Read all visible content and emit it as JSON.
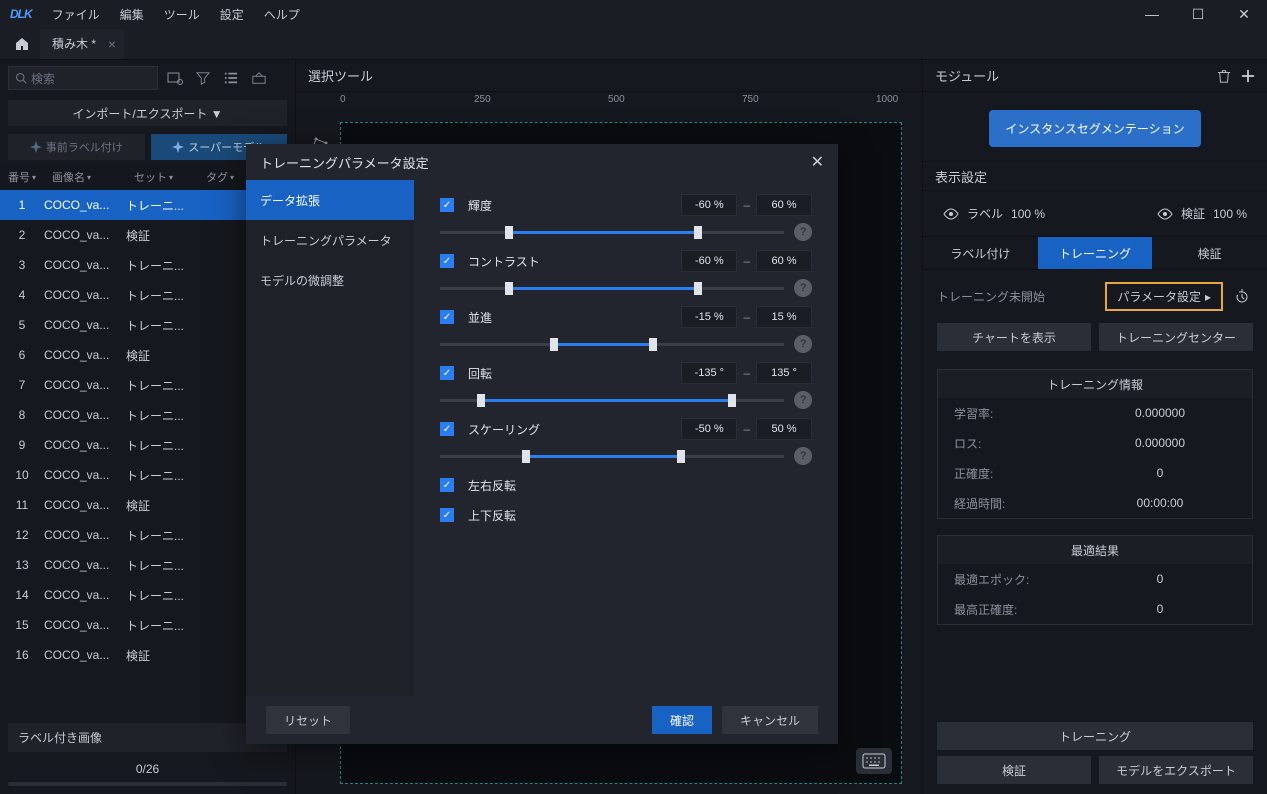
{
  "titlebar": {
    "logo": "DLK",
    "menu": {
      "file": "ファイル",
      "edit": "編集",
      "tool": "ツール",
      "settings": "設定",
      "help": "ヘルプ"
    }
  },
  "tab": {
    "name": "積み木 *"
  },
  "left": {
    "search_placeholder": "検索",
    "imp_exp": "インポート/エクスポート ▼",
    "pre_label": "事前ラベル付け",
    "super_model": "スーパーモデル",
    "cols": {
      "num": "番号",
      "name": "画像名",
      "set": "セット",
      "tag": "タグ"
    },
    "rows": [
      {
        "n": "1",
        "name": "COCO_va...",
        "set": "トレーニ..."
      },
      {
        "n": "2",
        "name": "COCO_va...",
        "set": "検証"
      },
      {
        "n": "3",
        "name": "COCO_va...",
        "set": "トレーニ..."
      },
      {
        "n": "4",
        "name": "COCO_va...",
        "set": "トレーニ..."
      },
      {
        "n": "5",
        "name": "COCO_va...",
        "set": "トレーニ..."
      },
      {
        "n": "6",
        "name": "COCO_va...",
        "set": "検証"
      },
      {
        "n": "7",
        "name": "COCO_va...",
        "set": "トレーニ..."
      },
      {
        "n": "8",
        "name": "COCO_va...",
        "set": "トレーニ..."
      },
      {
        "n": "9",
        "name": "COCO_va...",
        "set": "トレーニ..."
      },
      {
        "n": "10",
        "name": "COCO_va...",
        "set": "トレーニ..."
      },
      {
        "n": "11",
        "name": "COCO_va...",
        "set": "検証"
      },
      {
        "n": "12",
        "name": "COCO_va...",
        "set": "トレーニ..."
      },
      {
        "n": "13",
        "name": "COCO_va...",
        "set": "トレーニ..."
      },
      {
        "n": "14",
        "name": "COCO_va...",
        "set": "トレーニ..."
      },
      {
        "n": "15",
        "name": "COCO_va...",
        "set": "トレーニ..."
      },
      {
        "n": "16",
        "name": "COCO_va...",
        "set": "検証"
      }
    ],
    "labeled_img": "ラベル付き画像",
    "progress": "0/26"
  },
  "center": {
    "tool_title": "選択ツール",
    "ruler": {
      "t0": "0",
      "t250": "250",
      "t500": "500",
      "t750": "750",
      "t1000": "1000"
    }
  },
  "right": {
    "module": "モジュール",
    "module_chip": "インスタンスセグメンテーション",
    "disp": "表示設定",
    "eye_label": "ラベル",
    "eye_label_pct": "100  %",
    "eye_valid": "検証",
    "eye_valid_pct": "100  %",
    "tab_label": "ラベル付け",
    "tab_train": "トレーニング",
    "tab_valid": "検証",
    "status": "トレーニング未開始",
    "param_btn": "パラメータ設定",
    "show_chart": "チャートを表示",
    "train_center": "トレーニングセンター",
    "info_title": "トレーニング情報",
    "lr_k": "学習率:",
    "lr_v": "0.000000",
    "loss_k": "ロス:",
    "loss_v": "0.000000",
    "acc_k": "正確度:",
    "acc_v": "0",
    "time_k": "経過時間:",
    "time_v": "00:00:00",
    "best_title": "最適結果",
    "best_epoch_k": "最適エポック:",
    "best_epoch_v": "0",
    "best_acc_k": "最高正確度:",
    "best_acc_v": "0",
    "btn_train": "トレーニング",
    "btn_valid": "検証",
    "btn_export": "モデルをエクスポート"
  },
  "modal": {
    "title": "トレーニングパラメータ設定",
    "side": {
      "aug": "データ拡張",
      "param": "トレーニングパラメータ",
      "fine": "モデルの微調整"
    },
    "brightness": {
      "label": "輝度",
      "lo": "-60 %",
      "hi": "60 %"
    },
    "contrast": {
      "label": "コントラスト",
      "lo": "-60 %",
      "hi": "60 %"
    },
    "translate": {
      "label": "並進",
      "lo": "-15 %",
      "hi": "15 %"
    },
    "rotate": {
      "label": "回転",
      "lo": "-135 °",
      "hi": "135 °"
    },
    "scale": {
      "label": "スケーリング",
      "lo": "-50 %",
      "hi": "50 %"
    },
    "flip_h": "左右反転",
    "flip_v": "上下反転",
    "reset": "リセット",
    "ok": "確認",
    "cancel": "キャンセル"
  }
}
